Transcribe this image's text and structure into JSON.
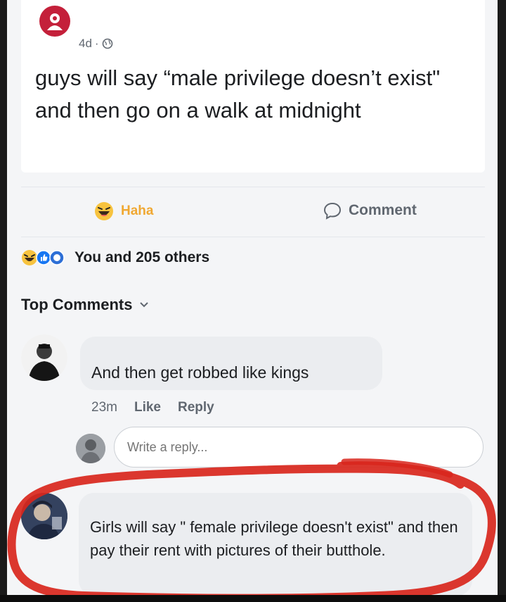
{
  "post": {
    "time": "4d",
    "text": "guys will say “male privilege doesn’t exist\" and then go on a walk at midnight"
  },
  "actions": {
    "haha_label": "Haha",
    "comment_label": "Comment"
  },
  "reactions": {
    "summary": "You and 205 others"
  },
  "comments_header": "Top Comments",
  "comments": [
    {
      "text": "And then get robbed like kings",
      "time": "23m",
      "like_label": "Like",
      "reply_label": "Reply"
    },
    {
      "text": "Girls will say \" female privilege doesn't exist\" and then pay their rent with pictures of their butthole."
    }
  ],
  "reply_box": {
    "placeholder": "Write a reply..."
  },
  "colors": {
    "haha": "#f0a832",
    "annotation": "#d8261c",
    "bubble": "#ebedf0"
  }
}
